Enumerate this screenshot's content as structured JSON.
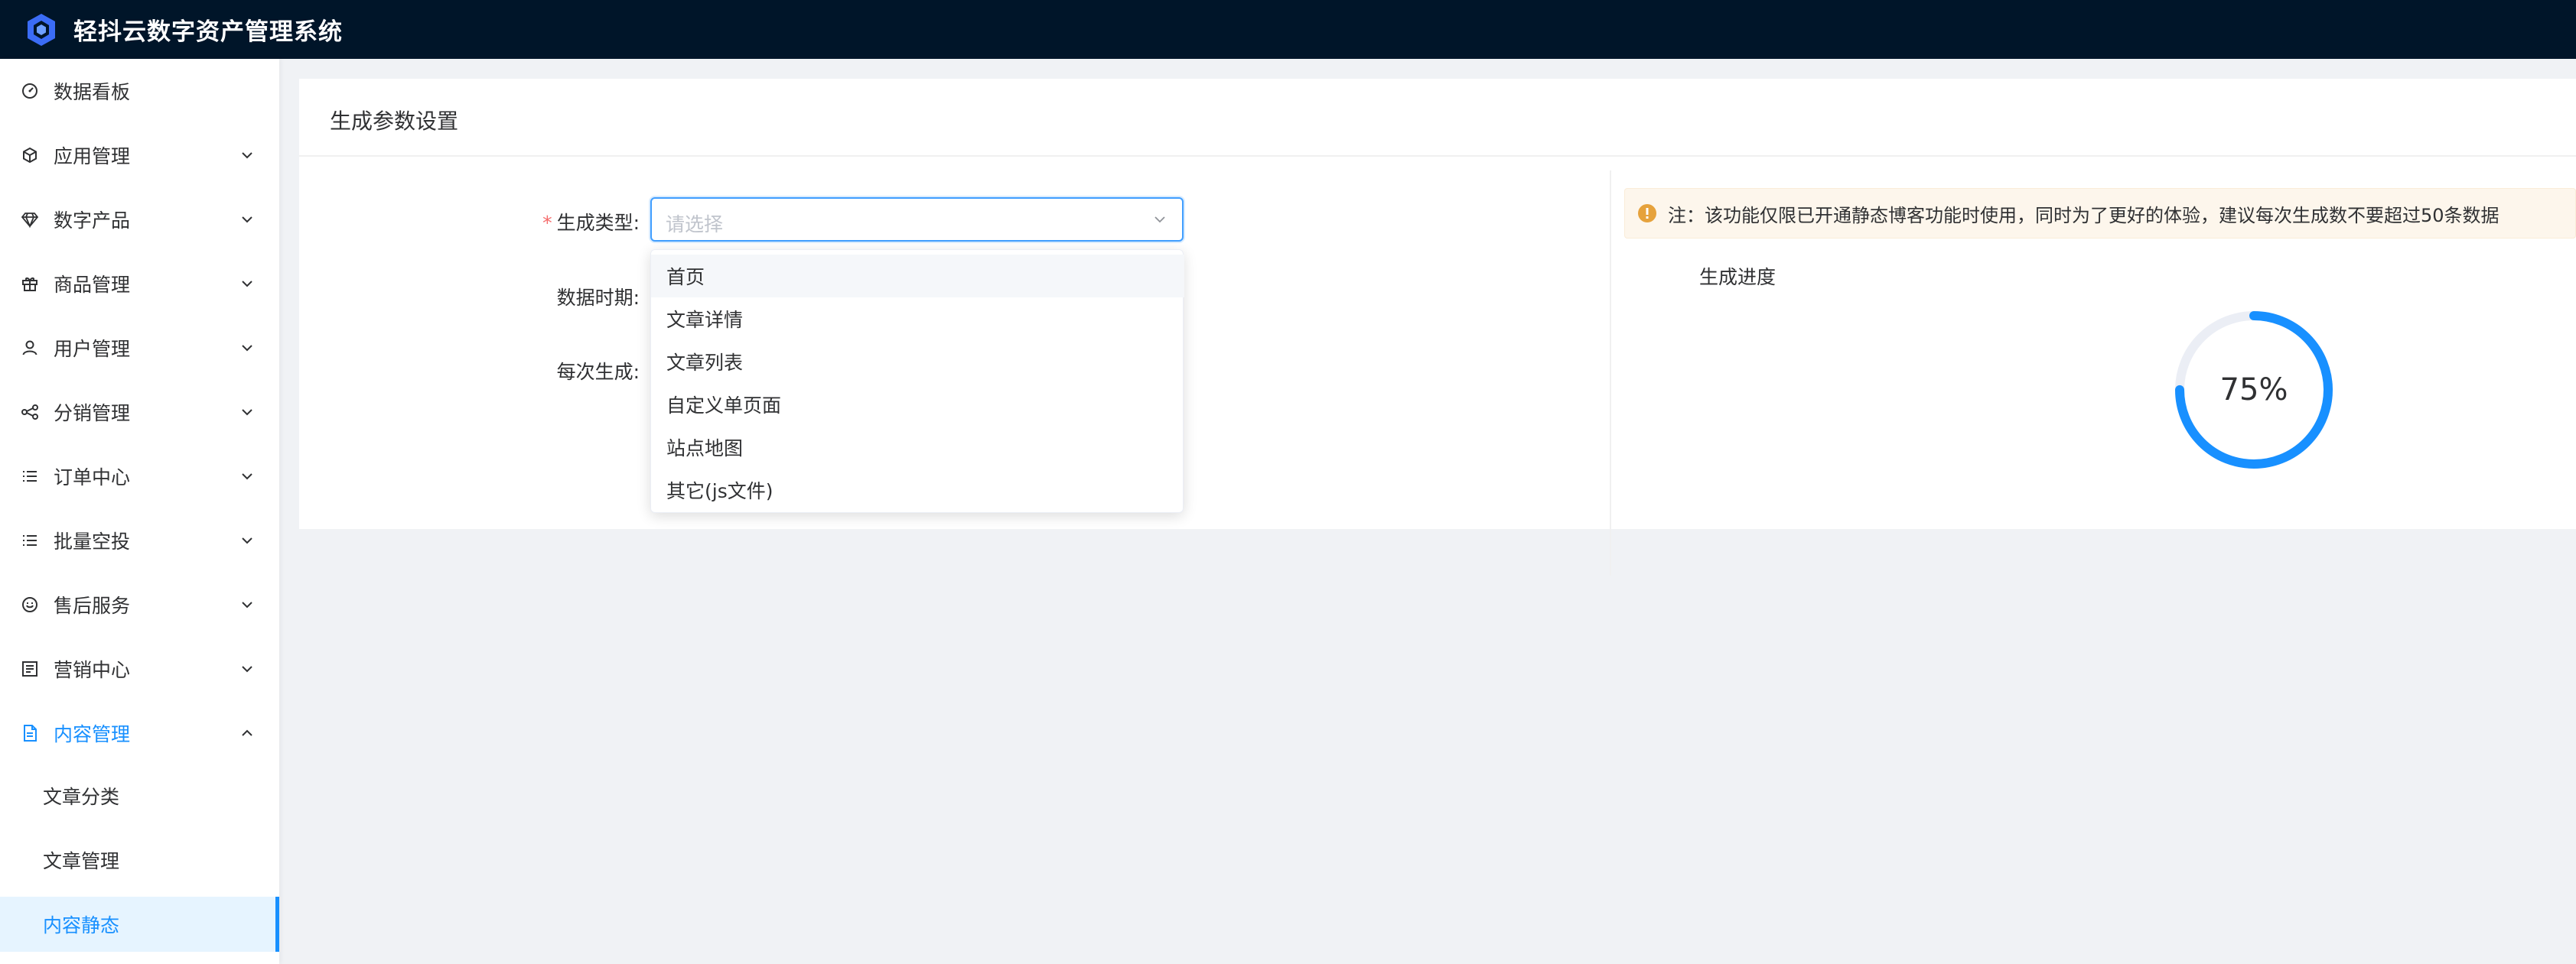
{
  "header": {
    "app_title": "轻抖云数字资产管理系统",
    "bg_color": "#001529"
  },
  "sidebar": {
    "items": [
      {
        "label": "数据看板",
        "icon": "dashboard-icon",
        "expandable": false
      },
      {
        "label": "应用管理",
        "icon": "cube-icon",
        "expandable": true
      },
      {
        "label": "数字产品",
        "icon": "diamond-icon",
        "expandable": true
      },
      {
        "label": "商品管理",
        "icon": "gift-icon",
        "expandable": true
      },
      {
        "label": "用户管理",
        "icon": "user-icon",
        "expandable": true
      },
      {
        "label": "分销管理",
        "icon": "share-icon",
        "expandable": true
      },
      {
        "label": "订单中心",
        "icon": "list-icon",
        "expandable": true
      },
      {
        "label": "批量空投",
        "icon": "list-icon",
        "expandable": true
      },
      {
        "label": "售后服务",
        "icon": "smile-icon",
        "expandable": true
      },
      {
        "label": "营销中心",
        "icon": "document-list-icon",
        "expandable": true
      },
      {
        "label": "内容管理",
        "icon": "file-icon",
        "expandable": true,
        "expanded": true,
        "active": true
      }
    ],
    "subitems": [
      {
        "label": "文章分类"
      },
      {
        "label": "文章管理"
      },
      {
        "label": "内容静态",
        "selected": true
      }
    ]
  },
  "card": {
    "title": "生成参数设置"
  },
  "form": {
    "type_label": "生成类型:",
    "type_required": "*",
    "type_placeholder": "请选择",
    "period_label": "数据时期:",
    "per_label": "每次生成:"
  },
  "dropdown": {
    "options": [
      "首页",
      "文章详情",
      "文章列表",
      "自定义单页面",
      "站点地图",
      "其它(js文件)"
    ],
    "hover_index": 0
  },
  "notice": {
    "text": "注：该功能仅限已开通静态博客功能时使用，同时为了更好的体验，建议每次生成数不要超过50条数据",
    "color": "#e6a23c"
  },
  "progress": {
    "label": "生成进度",
    "percent": 75,
    "percent_text": "75%",
    "color": "#1890ff"
  },
  "colors": {
    "accent": "#1890ff",
    "required": "#f56c6c"
  }
}
